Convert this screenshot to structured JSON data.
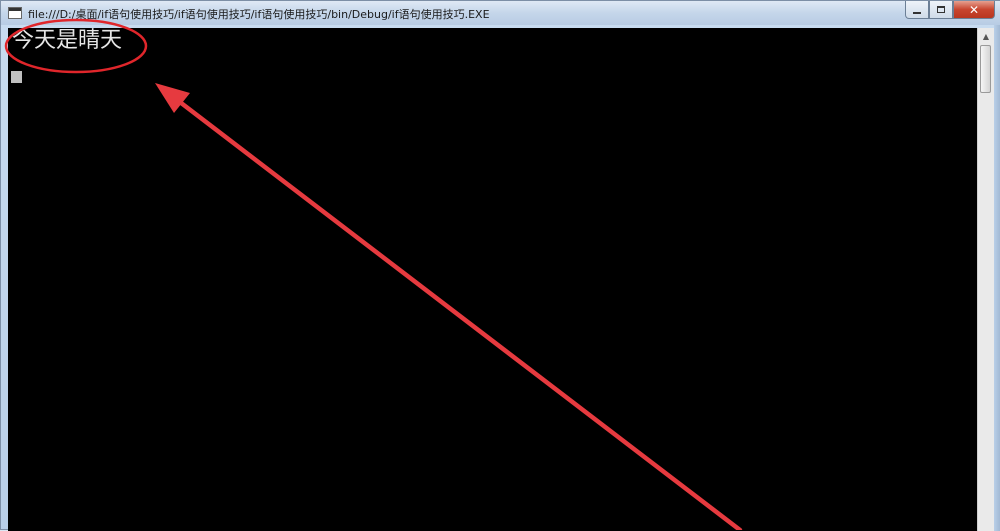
{
  "window": {
    "title": "file:///D:/桌面/if语句使用技巧/if语句使用技巧/if语句使用技巧/bin/Debug/if语句使用技巧.EXE",
    "icon": "console-app-icon",
    "controls": {
      "minimize": "minimize-icon",
      "maximize": "maximize-icon",
      "close": "close-icon",
      "close_glyph": "✕"
    }
  },
  "console": {
    "output_line": "今天是晴天",
    "background": "#000000",
    "text_color": "#e6e6e6"
  },
  "annotations": {
    "circle_color": "#e0262b",
    "arrow_color": "#e63a3f"
  }
}
